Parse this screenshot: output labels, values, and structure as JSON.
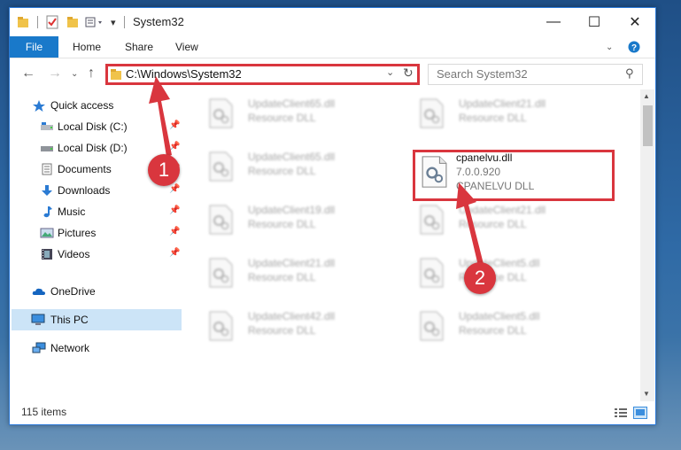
{
  "window": {
    "title": "System32"
  },
  "ribbon": {
    "file": "File",
    "tabs": [
      "Home",
      "Share",
      "View"
    ]
  },
  "address": {
    "path": "C:\\Windows\\System32"
  },
  "search": {
    "placeholder": "Search System32"
  },
  "nav": {
    "items": [
      {
        "label": "Quick access",
        "icon": "star-icon"
      },
      {
        "label": "Local Disk (C:)",
        "icon": "drive-icon"
      },
      {
        "label": "Local Disk (D:)",
        "icon": "drive-icon"
      },
      {
        "label": "Documents",
        "icon": "documents-icon"
      },
      {
        "label": "Downloads",
        "icon": "download-icon"
      },
      {
        "label": "Music",
        "icon": "music-icon"
      },
      {
        "label": "Pictures",
        "icon": "pictures-icon"
      },
      {
        "label": "Videos",
        "icon": "videos-icon"
      },
      {
        "label": "OneDrive",
        "icon": "cloud-icon"
      },
      {
        "label": "This PC",
        "icon": "pc-icon"
      },
      {
        "label": "Network",
        "icon": "network-icon"
      }
    ]
  },
  "files": [
    {
      "name": "UpdateClient65.dll",
      "sub": "Resource DLL"
    },
    {
      "name": "UpdateClient21.dll",
      "sub": "Resource DLL"
    },
    {
      "name": "UpdateClient65.dll",
      "sub": "Resource DLL"
    },
    {
      "name": "cpanelvu.dll",
      "version": "7.0.0.920",
      "sub": "CPANELVU DLL"
    },
    {
      "name": "UpdateClient19.dll",
      "sub": "Resource DLL"
    },
    {
      "name": "UpdateClient21.dll",
      "sub": "Resource DLL"
    },
    {
      "name": "UpdateClient21.dll",
      "sub": "Resource DLL"
    },
    {
      "name": "UpdateClient5.dll",
      "sub": "Resource DLL"
    },
    {
      "name": "UpdateClient42.dll",
      "sub": "Resource DLL"
    },
    {
      "name": "UpdateClient5.dll",
      "sub": "Resource DLL"
    }
  ],
  "status": {
    "count": "115 items"
  },
  "callouts": {
    "one": "1",
    "two": "2"
  },
  "colors": {
    "accent": "#1979ca",
    "highlight": "#d9363e",
    "selection": "#cce4f7"
  }
}
